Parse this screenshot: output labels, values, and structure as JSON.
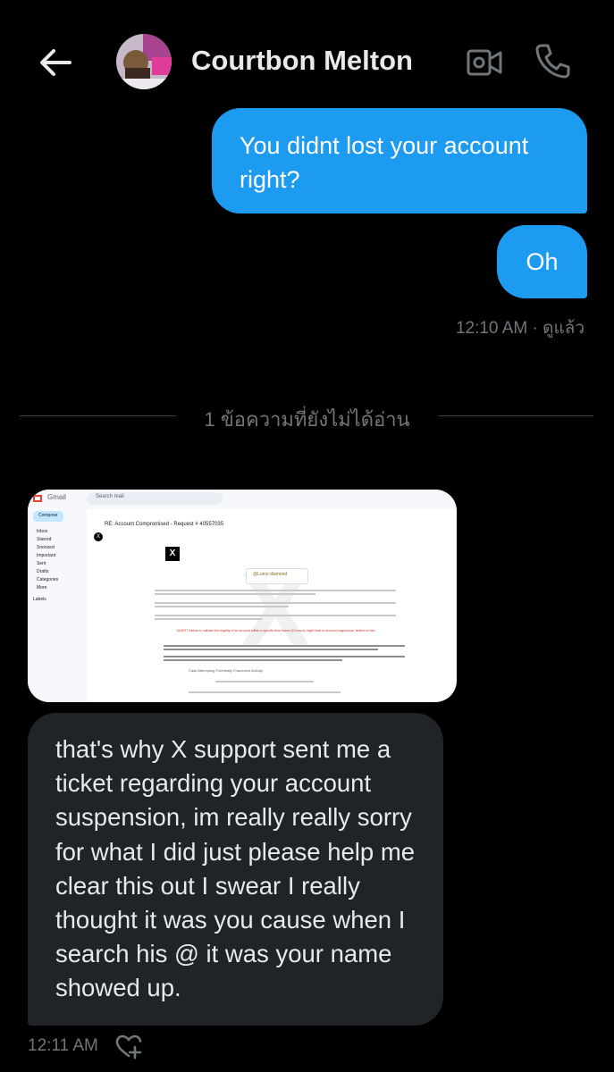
{
  "header": {
    "contact_name": "Courtbon Melton",
    "back_icon": "arrow-left-icon",
    "video_icon": "video-call-icon",
    "phone_icon": "phone-icon"
  },
  "messages": {
    "sent": [
      {
        "text": "You didnt lost your account right?"
      },
      {
        "text": "Oh"
      }
    ],
    "sent_meta": "12:10 AM · ดูแล้ว",
    "unread_divider": "1 ข้อความที่ยังไม่ได้อ่าน",
    "received_text": "that's why X support sent me a ticket regarding your account suspension, im really really sorry for what I did just please help me clear this out I swear I really thought it was you cause when I search his @ it was your name showed up.",
    "received_meta": "12:11 AM",
    "react_icon": "heart-plus-icon"
  },
  "attachment": {
    "app_name": "Gmail",
    "search_placeholder": "Search mail",
    "compose": "Compose",
    "folders": [
      "Inbox",
      "Starred",
      "Snoozed",
      "Important",
      "Sent",
      "Drafts",
      "Categories",
      "More"
    ],
    "labels": "Labels",
    "subject": "RE: Account Compromised - Request # 40557035",
    "sender_initial": "X",
    "brand": "@Lumo diamond",
    "alert": "ALERT! Failure to validate the legality of an account within a specific time frame (12 hours) might lead to account suspension, limited or ban.",
    "footer": "Case Attempting Potentially Fraudulent Activity"
  },
  "colors": {
    "accent": "#1d9bf0",
    "background": "#000000",
    "received_bubble": "#202327",
    "muted_text": "#71767b"
  }
}
